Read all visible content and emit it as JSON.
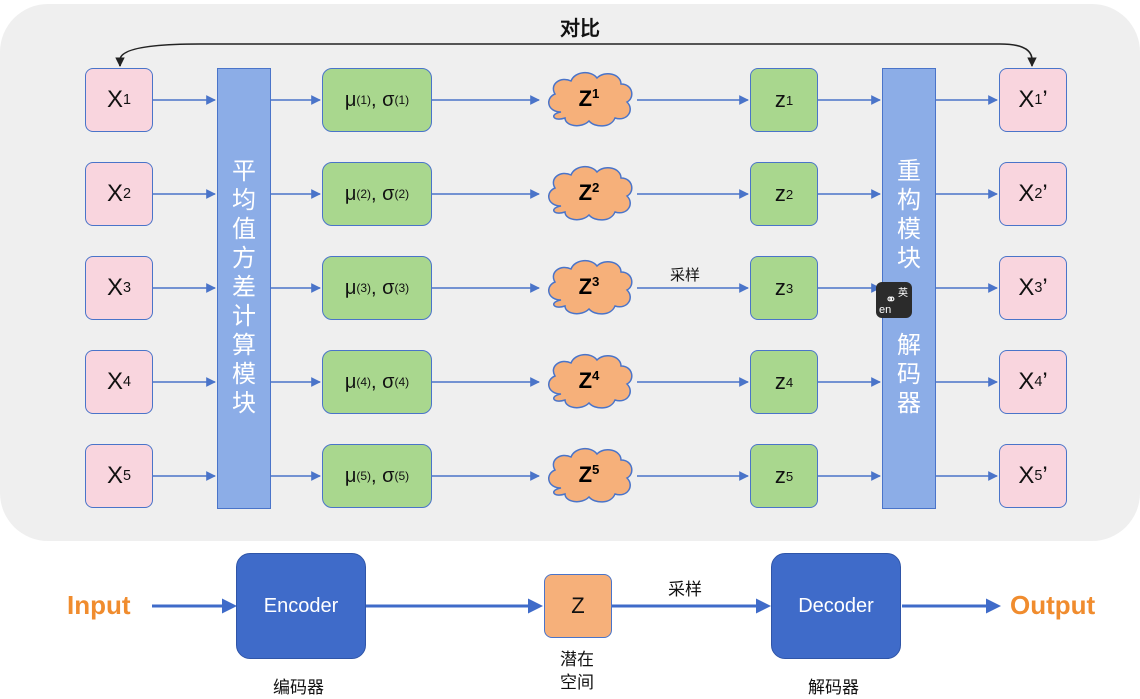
{
  "title": "对比",
  "inputs": [
    {
      "base": "X",
      "sub": "1"
    },
    {
      "base": "X",
      "sub": "2"
    },
    {
      "base": "X",
      "sub": "3"
    },
    {
      "base": "X",
      "sub": "4"
    },
    {
      "base": "X",
      "sub": "5"
    }
  ],
  "params": [
    {
      "mu": "μ",
      "sigma": "σ",
      "idx": "(1)",
      "sep": ", "
    },
    {
      "mu": "μ",
      "sigma": "σ",
      "idx": "(2)",
      "sep": ", "
    },
    {
      "mu": "μ",
      "sigma": "σ",
      "idx": "(3)",
      "sep": ", "
    },
    {
      "mu": "μ",
      "sigma": "σ",
      "idx": "(4)",
      "sep": ", "
    },
    {
      "mu": "μ",
      "sigma": "σ",
      "idx": "(5)",
      "sep": ", "
    }
  ],
  "clouds": [
    {
      "base": "Z",
      "sup": "1"
    },
    {
      "base": "Z",
      "sup": "2"
    },
    {
      "base": "Z",
      "sup": "3"
    },
    {
      "base": "Z",
      "sup": "4"
    },
    {
      "base": "Z",
      "sup": "5"
    }
  ],
  "latents": [
    {
      "base": "z",
      "sub": "1"
    },
    {
      "base": "z",
      "sub": "2"
    },
    {
      "base": "z",
      "sub": "3"
    },
    {
      "base": "z",
      "sub": "4"
    },
    {
      "base": "z",
      "sub": "5"
    }
  ],
  "outputs": [
    {
      "base": "X",
      "sub": "1",
      "prime": "’"
    },
    {
      "base": "X",
      "sub": "2",
      "prime": "’"
    },
    {
      "base": "X",
      "sub": "3",
      "prime": "’"
    },
    {
      "base": "X",
      "sub": "4",
      "prime": "’"
    },
    {
      "base": "X",
      "sub": "5",
      "prime": "’"
    }
  ],
  "encoder_module": "平均值方差计算模块",
  "decoder_module_top": "重构模块",
  "decoder_module_bottom": "解码器",
  "sample_label": "采样",
  "badge_top": "英",
  "badge_bottom": "en",
  "bottom": {
    "input": "Input",
    "encoder": "Encoder",
    "encoder_cn": "编码器",
    "z": "Z",
    "z_cn_1": "潜在",
    "z_cn_2": "空间",
    "sample": "采样",
    "decoder": "Decoder",
    "decoder_cn": "解码器",
    "output": "Output"
  },
  "colors": {
    "panel": "#efefef",
    "input_box": "#f9d5de",
    "green_box": "#a9d78e",
    "cloud": "#f6b07a",
    "module_bar": "#8cade7",
    "arrow": "#4a74c9",
    "big_box": "#3f6bc9",
    "accent_orange": "#f08c2e"
  }
}
